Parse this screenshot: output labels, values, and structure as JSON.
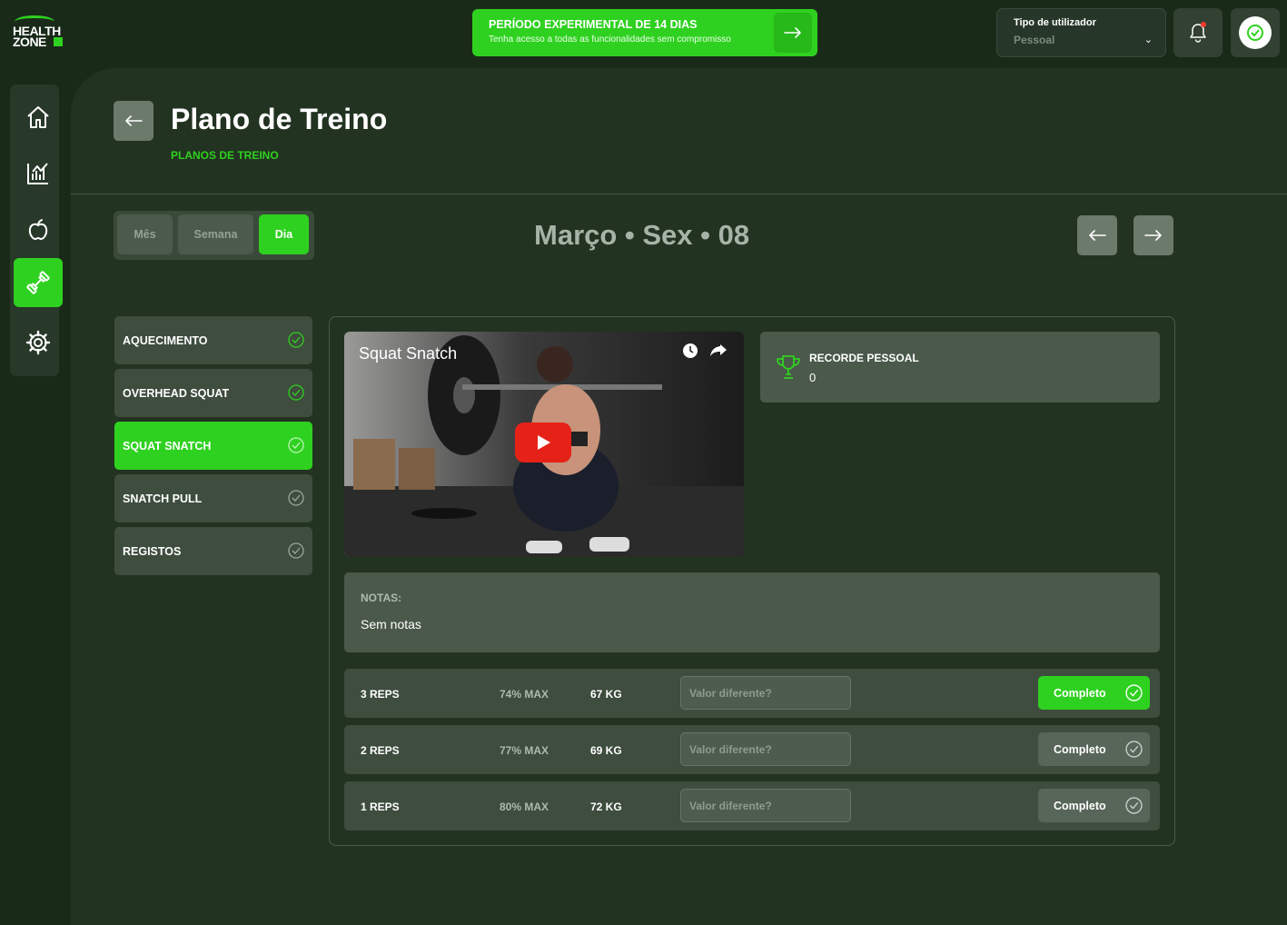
{
  "brand": {
    "line1": "HEALTH",
    "line2": "ZONE"
  },
  "trial": {
    "title": "PERÍODO EXPERIMENTAL DE 14 DIAS",
    "subtitle": "Tenha acesso a todas as funcionalidades sem compromisso"
  },
  "user_type": {
    "label": "Tipo de utilizador",
    "value": "Pessoal"
  },
  "sidebar": {
    "items": [
      {
        "icon": "home-icon"
      },
      {
        "icon": "chart-icon"
      },
      {
        "icon": "apple-icon"
      },
      {
        "icon": "dumbbell-icon",
        "active": true
      },
      {
        "icon": "gear-icon"
      }
    ]
  },
  "page": {
    "title": "Plano de Treino",
    "breadcrumb": "PLANOS DE TREINO"
  },
  "view_tabs": {
    "month": "Mês",
    "week": "Semana",
    "day": "Dia",
    "active": "Dia"
  },
  "date_label": "Março • Sex • 08",
  "exercises": [
    {
      "label": "AQUECIMENTO",
      "active": false
    },
    {
      "label": "OVERHEAD SQUAT",
      "active": false
    },
    {
      "label": "SQUAT SNATCH",
      "active": true
    },
    {
      "label": "SNATCH PULL",
      "active": false
    },
    {
      "label": "REGISTOS",
      "active": false
    }
  ],
  "video": {
    "title": "Squat Snatch"
  },
  "record": {
    "label": "RECORDE PESSOAL",
    "value": "0"
  },
  "notes": {
    "label": "NOTAS:",
    "value": "Sem notas"
  },
  "sets": [
    {
      "reps": "3 REPS",
      "pct": "74% MAX",
      "kg": "67 KG",
      "placeholder": "Valor diferente?",
      "button": "Completo",
      "completed": true
    },
    {
      "reps": "2 REPS",
      "pct": "77% MAX",
      "kg": "69 KG",
      "placeholder": "Valor diferente?",
      "button": "Completo",
      "completed": false
    },
    {
      "reps": "1 REPS",
      "pct": "80% MAX",
      "kg": "72 KG",
      "placeholder": "Valor diferente?",
      "button": "Completo",
      "completed": false
    }
  ],
  "colors": {
    "accent": "#2fd120",
    "background": "#1a2a19",
    "panel": "#223321"
  }
}
